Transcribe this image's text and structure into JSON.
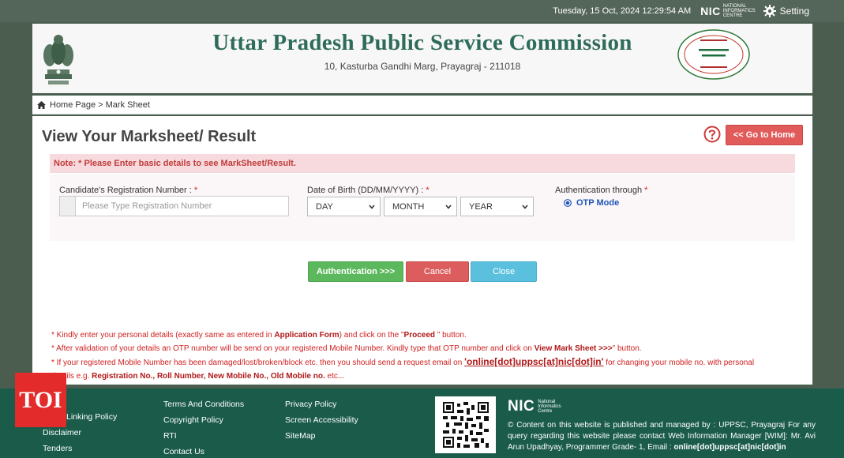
{
  "topbar": {
    "datetime": "Tuesday, 15 Oct, 2024 12:29:54 AM",
    "nic_text": "NIC",
    "nic_sub1": "NATIONAL",
    "nic_sub2": "INFORMATICS",
    "nic_sub3": "CENTRE",
    "setting_label": "Setting"
  },
  "header": {
    "title": "Uttar Pradesh Public Service Commission",
    "address": "10, Kasturba Gandhi Marg, Prayagraj - 211018"
  },
  "breadcrumb": {
    "home": "Home Page",
    "separator": " > ",
    "current": "Mark Sheet"
  },
  "page": {
    "title": "View Your Marksheet/ Result",
    "go_home": "<< Go to Home"
  },
  "note": {
    "label": "Note:",
    "text": " * Please Enter basic details to see MarkSheet/Result."
  },
  "form": {
    "reg_label": "Candidate's Registration Number : ",
    "reg_placeholder": "Please Type Registration Number",
    "dob_label": "Date of Birth (DD/MM/YYYY) : ",
    "day": "DAY",
    "month": "MONTH",
    "year": "YEAR",
    "auth_label": "Authentication through ",
    "otp_mode": "OTP Mode",
    "required": "*"
  },
  "buttons": {
    "authenticate": "Authentication >>>",
    "cancel": "Cancel",
    "close": "Close"
  },
  "instructions": {
    "line1_a": "* Kindly enter your personal details (exactly same as entered in ",
    "line1_b": "Application Form",
    "line1_c": ") and click on the \"",
    "line1_d": "Proceed",
    "line1_e": " \" button.",
    "line2_a": "* After validation of your details an OTP number will be send on your registered Mobile Number. Kindly type that OTP number and click on ",
    "line2_b": "View Mark Sheet >>>",
    "line2_c": "\" button.",
    "line3_a": "* If your registered Mobile Number has been damaged/lost/broken/block etc. then you should send a request email on ",
    "line3_email": "'online[dot]uppsc[at]nic[dot]in'",
    "line3_b": " for changing your mobile no. with personal",
    "line4_a": "details e.g. ",
    "line4_b": "Registration No., Roll Number, New Mobile No., Old Mobile no.",
    "line4_c": " etc..."
  },
  "footer": {
    "col1": [
      "Linking Policy",
      "Disclaimer",
      "Tenders"
    ],
    "col2": [
      "Terms And Conditions",
      "Copyright Policy",
      "RTI",
      "Contact Us"
    ],
    "col3": [
      "Privacy Policy",
      "Screen Accessibility",
      "SiteMap"
    ],
    "nic_text": "NIC",
    "nic_sub1": "National",
    "nic_sub2": "Informatics",
    "nic_sub3": "Centre",
    "info_a": "© Content on this website is published and managed by : UPPSC, Prayagraj For any query regarding this website please contact Web Information Manager [WIM]: Mr. Avi Arun Upadhyay, Programmer Grade- 1, Email : ",
    "info_email": "online[dot]uppsc[at]nic[dot]in"
  },
  "watermark": {
    "text": "TOI"
  },
  "colors": {
    "brand_green": "#2e6b5b",
    "footer_green": "#1a5b4a",
    "danger": "#e15b5b",
    "success": "#5cb85c",
    "info": "#5bc0de"
  }
}
